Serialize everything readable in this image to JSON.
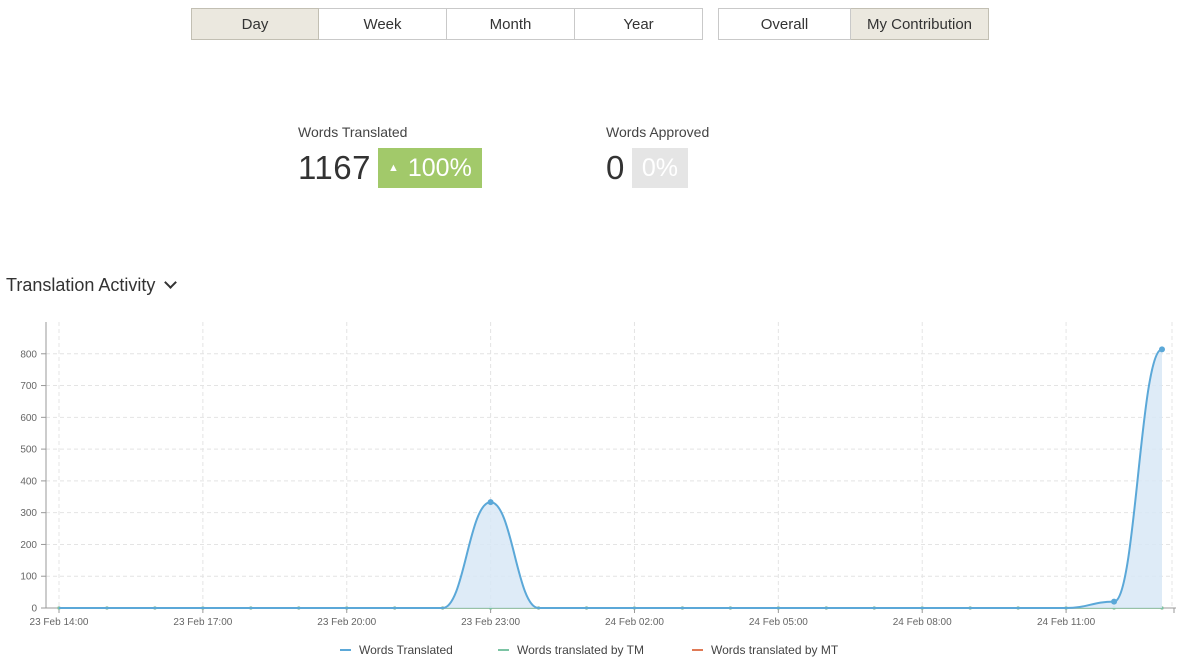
{
  "period_buttons": [
    {
      "label": "Day",
      "active": true
    },
    {
      "label": "Week",
      "active": false
    },
    {
      "label": "Month",
      "active": false
    },
    {
      "label": "Year",
      "active": false
    }
  ],
  "scope_buttons": [
    {
      "label": "Overall",
      "active": false
    },
    {
      "label": "My Contribution",
      "active": true
    }
  ],
  "stats": {
    "translated": {
      "label": "Words Translated",
      "value": "1167",
      "change": "100%",
      "trend_icon": "triangle-up-icon"
    },
    "approved": {
      "label": "Words Approved",
      "value": "0",
      "change": "0%"
    }
  },
  "section": {
    "title": "Translation Activity"
  },
  "colors": {
    "translated": "#5ba8d8",
    "tm": "#7cc4a4",
    "mt": "#e07a56",
    "fill": "#d8e8f6",
    "badge_up": "#a2c96a",
    "badge_zero": "#e5e5e5"
  },
  "chart_data": {
    "type": "area",
    "x_labels": [
      "23 Feb 14:00",
      "23 Feb 17:00",
      "23 Feb 20:00",
      "23 Feb 23:00",
      "24 Feb 02:00",
      "24 Feb 05:00",
      "24 Feb 08:00",
      "24 Feb 11:00"
    ],
    "x": [
      "23 Feb 14:00",
      "23 Feb 15:00",
      "23 Feb 16:00",
      "23 Feb 17:00",
      "23 Feb 18:00",
      "23 Feb 19:00",
      "23 Feb 20:00",
      "23 Feb 21:00",
      "23 Feb 22:00",
      "23 Feb 23:00",
      "24 Feb 00:00",
      "24 Feb 01:00",
      "24 Feb 02:00",
      "24 Feb 03:00",
      "24 Feb 04:00",
      "24 Feb 05:00",
      "24 Feb 06:00",
      "24 Feb 07:00",
      "24 Feb 08:00",
      "24 Feb 09:00",
      "24 Feb 10:00",
      "24 Feb 11:00",
      "24 Feb 12:00",
      "24 Feb 13:00"
    ],
    "y_ticks": [
      0,
      100,
      200,
      300,
      400,
      500,
      600,
      700,
      800
    ],
    "ylim": [
      0,
      900
    ],
    "series": [
      {
        "name": "Words Translated",
        "values": [
          0,
          0,
          0,
          0,
          0,
          0,
          0,
          0,
          0,
          333,
          0,
          0,
          0,
          0,
          0,
          0,
          0,
          0,
          0,
          0,
          0,
          0,
          20,
          814
        ]
      },
      {
        "name": "Words translated by TM",
        "values": [
          0,
          0,
          0,
          0,
          0,
          0,
          0,
          0,
          0,
          0,
          0,
          0,
          0,
          0,
          0,
          0,
          0,
          0,
          0,
          0,
          0,
          0,
          0,
          0
        ]
      },
      {
        "name": "Words translated by MT",
        "values": [
          0,
          0,
          0,
          0,
          0,
          0,
          0,
          0,
          0,
          0,
          0,
          0,
          0,
          0,
          0,
          0,
          0,
          0,
          0,
          0,
          0,
          0,
          0,
          0
        ]
      }
    ],
    "grid": true,
    "legend": "bottom"
  }
}
